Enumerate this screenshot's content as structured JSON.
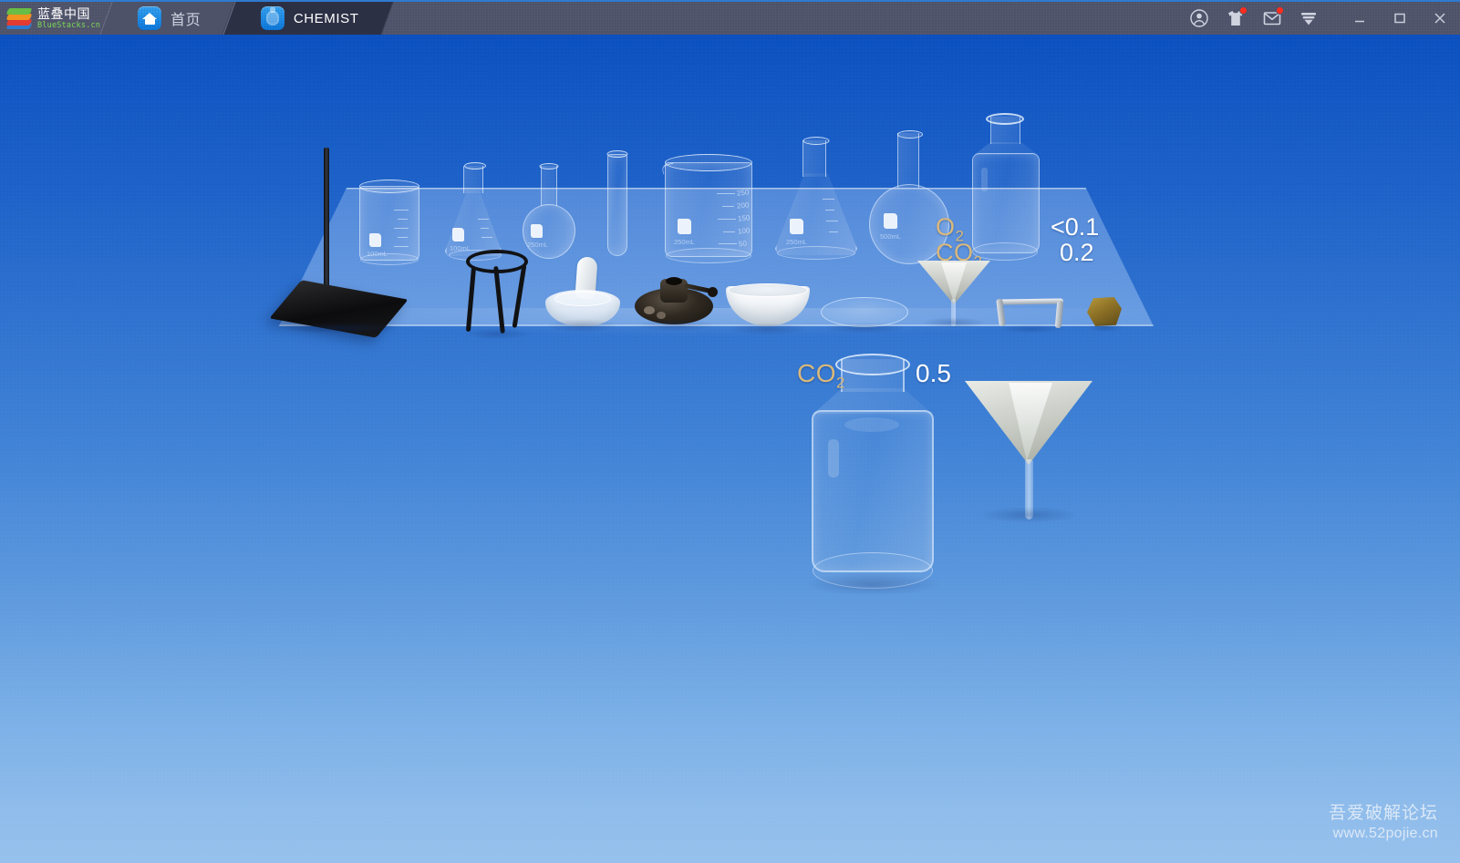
{
  "titlebar": {
    "brand_cn": "蓝叠中国",
    "brand_en": "BlueStacks.cn",
    "tabs": [
      {
        "label": "首页",
        "icon": "home-icon",
        "active": false
      },
      {
        "label": "CHEMIST",
        "icon": "chemist-app-icon",
        "active": true
      }
    ],
    "controls": [
      {
        "name": "account-icon",
        "badge": false
      },
      {
        "name": "gift-shirt-icon",
        "badge": true
      },
      {
        "name": "mail-icon",
        "badge": true
      },
      {
        "name": "download-icon",
        "badge": false
      }
    ],
    "window_buttons": [
      {
        "name": "minimize-button",
        "glyph": "—"
      },
      {
        "name": "maximize-button",
        "glyph": "▢"
      },
      {
        "name": "close-button",
        "glyph": "✕"
      }
    ]
  },
  "game": {
    "app_name": "CHEMIST",
    "shelf_items": [
      {
        "name": "retort-stand",
        "label": ""
      },
      {
        "name": "beaker-small",
        "label": "100mL"
      },
      {
        "name": "erlenmeyer-flask-small",
        "label": "100mL"
      },
      {
        "name": "florence-flask-small",
        "label": "250mL"
      },
      {
        "name": "test-tube",
        "label": ""
      },
      {
        "name": "beaker-large",
        "label": "250mL"
      },
      {
        "name": "erlenmeyer-flask-large",
        "label": "250mL"
      },
      {
        "name": "florence-flask-large",
        "label": "500mL"
      },
      {
        "name": "reagent-bottle-back",
        "label": ""
      },
      {
        "name": "tripod-stand",
        "label": ""
      },
      {
        "name": "mortar-and-pestle",
        "label": ""
      },
      {
        "name": "alcohol-burner",
        "label": ""
      },
      {
        "name": "evaporating-dish",
        "label": ""
      },
      {
        "name": "watch-glass",
        "label": ""
      },
      {
        "name": "funnel-back",
        "label": ""
      },
      {
        "name": "metal-clamp",
        "label": ""
      },
      {
        "name": "mineral-sample",
        "label": ""
      }
    ],
    "beaker_large_graduations": [
      "250",
      "200",
      "150",
      "100",
      "50"
    ],
    "beaker_large_volume": "250mL",
    "beaker_small_volume": "100mL",
    "flask_large_volume": "250mL",
    "flask_small_volume": "100mL",
    "florence_small_volume": "250mL",
    "florence_large_volume": "500mL",
    "back_bottle": {
      "gas_1": "O",
      "gas_1_sub": "2",
      "gas_1_value": "<0.1",
      "gas_2": "CO",
      "gas_2_sub": "2",
      "gas_2_value": "0.2"
    },
    "front_bottle": {
      "gas": "CO",
      "gas_sub": "2",
      "value": "0.5",
      "name": "reagent-bottle-front"
    },
    "front_funnel": {
      "name": "funnel-front-with-filter-paper"
    },
    "colors": {
      "gas_label": "#d9b87c",
      "value_label": "#ffffff",
      "background_top": "#0b50bf",
      "background_bottom": "#97c1ed",
      "titlebar": "#4d5268",
      "tab_active": "#2c3045",
      "accent_blue": "#2f7ad0",
      "badge_red": "#ff2d1e"
    }
  },
  "watermark": {
    "line1": "吾爱破解论坛",
    "line2": "www.52pojie.cn"
  }
}
